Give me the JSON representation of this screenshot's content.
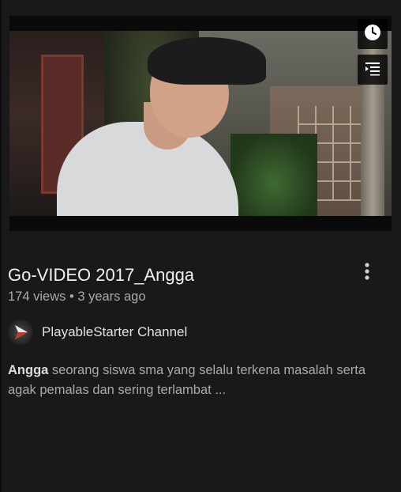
{
  "video": {
    "title": "Go-VIDEO 2017_Angga",
    "meta": "174 views • 3 years ago",
    "description_bold": "Angga",
    "description_rest": " seorang siswa sma yang selalu terkena masalah serta agak pemalas dan sering terlambat ..."
  },
  "channel": {
    "name": "PlayableStarter Channel"
  },
  "overlay_buttons": [
    {
      "icon": "clock-icon"
    },
    {
      "icon": "add-to-queue-icon"
    }
  ],
  "menu": {
    "icon": "more-vertical-icon"
  },
  "colors": {
    "background": "#191919",
    "title": "#f1f1f1",
    "secondary": "#aaaaaa"
  }
}
